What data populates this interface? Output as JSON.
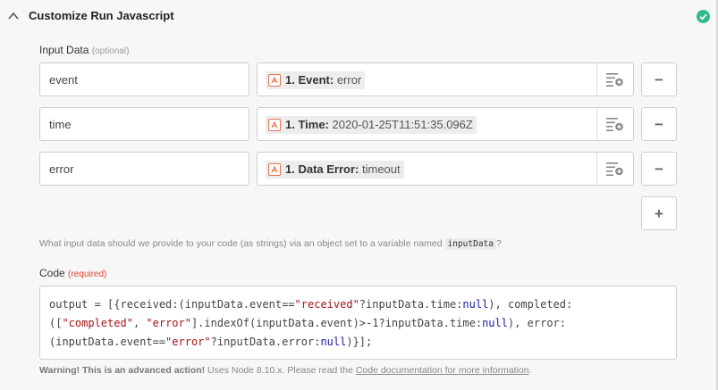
{
  "header": {
    "title": "Customize Run Javascript",
    "status_icon": "check-circle-icon",
    "colors": {
      "success": "#2fb98d",
      "token_icon": "#e8734f"
    }
  },
  "input_data": {
    "label": "Input Data",
    "optional_tag": "(optional)",
    "rows": [
      {
        "key": "event",
        "token_label": "1. Event:",
        "token_value": "error"
      },
      {
        "key": "time",
        "token_label": "1. Time:",
        "token_value": "2020-01-25T11:51:35.096Z"
      },
      {
        "key": "error",
        "token_label": "1. Data Error:",
        "token_value": "timeout"
      }
    ],
    "remove_symbol": "−",
    "add_symbol": "+",
    "help_prefix": "What input data should we provide to your code (as strings) via an object set to a variable named",
    "help_code": "inputData",
    "help_suffix": "?"
  },
  "code": {
    "label": "Code",
    "required_tag": "(required)",
    "lines": [
      [
        {
          "t": "output = [{received:(inputData.event==",
          "c": ""
        },
        {
          "t": "\"received\"",
          "c": "str"
        },
        {
          "t": "?inputData.time:",
          "c": ""
        },
        {
          "t": "null",
          "c": "kw"
        },
        {
          "t": "), completed:",
          "c": ""
        }
      ],
      [
        {
          "t": "([",
          "c": ""
        },
        {
          "t": "\"completed\"",
          "c": "str"
        },
        {
          "t": ", ",
          "c": ""
        },
        {
          "t": "\"error\"",
          "c": "str"
        },
        {
          "t": "].indexOf(inputData.event)>-1?inputData.time:",
          "c": ""
        },
        {
          "t": "null",
          "c": "kw"
        },
        {
          "t": "), error:",
          "c": ""
        }
      ],
      [
        {
          "t": "(inputData.event==",
          "c": ""
        },
        {
          "t": "\"error\"",
          "c": "str"
        },
        {
          "t": "?inputData.error:",
          "c": ""
        },
        {
          "t": "null",
          "c": "kw"
        },
        {
          "t": ")}];",
          "c": ""
        }
      ]
    ]
  },
  "warning": {
    "bold": "Warning! This is an advanced action!",
    "text": " Uses Node 8.10.x. Please read the ",
    "link": "Code documentation for more information",
    "end": "."
  }
}
